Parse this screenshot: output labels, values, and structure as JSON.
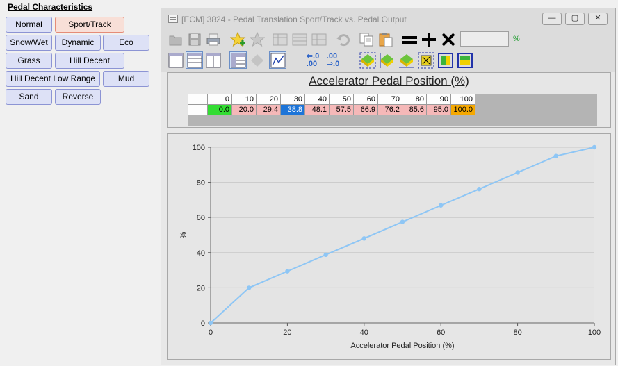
{
  "left_panel": {
    "title": "Pedal Characteristics",
    "buttons": [
      {
        "label": "Normal",
        "active": false
      },
      {
        "label": "Sport/Track",
        "active": true
      },
      {
        "label": "Snow/Wet",
        "active": false
      },
      {
        "label": "Dynamic",
        "active": false
      },
      {
        "label": "Eco",
        "active": false
      },
      {
        "label": "Grass",
        "active": false
      },
      {
        "label": "Hill Decent",
        "active": false
      },
      {
        "label": "Hill Decent Low Range",
        "active": false
      },
      {
        "label": "Mud",
        "active": false
      },
      {
        "label": "Sand",
        "active": false
      },
      {
        "label": "Reverse",
        "active": false
      }
    ]
  },
  "window": {
    "title": "[ECM] 3824 - Pedal Translation Sport/Track vs. Pedal Output",
    "controls": {
      "minimize": "—",
      "maximize": "▢",
      "close": "✕"
    },
    "unit_label": "%",
    "value_box": ""
  },
  "toolbar": {
    "row1_icons": [
      "open-icon",
      "save-icon",
      "print-icon",
      "add-favorite-icon",
      "remove-favorite-icon",
      "table-col-icon",
      "table-row-icon",
      "table-cell-icon",
      "undo-icon",
      "copy-icon",
      "paste-icon",
      "equals-icon",
      "plus-icon",
      "multiply-icon"
    ],
    "row2_icons": [
      "view-table-icon",
      "view-split-h-icon",
      "view-split-v-icon",
      "view-grid-icon",
      "view-3d-icon",
      "view-graph-icon",
      "decimal-left-icon",
      "decimal-right-icon",
      "fill-up-icon",
      "fill-left-icon",
      "fill-diag-icon",
      "select-icon",
      "color-h-icon",
      "color-v-icon"
    ],
    "dec_left": [
      "⇐.0",
      ".00"
    ],
    "dec_right": [
      ".00",
      "⇒.0"
    ]
  },
  "table": {
    "title": "Accelerator Pedal Position (%)",
    "headers": [
      "0",
      "10",
      "20",
      "30",
      "40",
      "50",
      "60",
      "70",
      "80",
      "90",
      "100"
    ],
    "values": [
      "0.0",
      "20.0",
      "29.4",
      "38.8",
      "48.1",
      "57.5",
      "66.9",
      "76.2",
      "85.6",
      "95.0",
      "100.0"
    ],
    "colors": {
      "first": "#33dd33",
      "selected": "#1c74d8",
      "last": "#f5a800",
      "default": "#f5b8b8"
    }
  },
  "chart_data": {
    "type": "line",
    "title": "",
    "xlabel": "Accelerator Pedal Position (%)",
    "ylabel": "%",
    "x": [
      0,
      10,
      20,
      30,
      40,
      50,
      60,
      70,
      80,
      90,
      100
    ],
    "series": [
      {
        "values": [
          0,
          20.0,
          29.4,
          38.8,
          48.1,
          57.5,
          66.9,
          76.2,
          85.6,
          95.0,
          100.0
        ]
      }
    ],
    "xlim": [
      0,
      100
    ],
    "ylim": [
      0,
      100
    ],
    "xticks": [
      "0",
      "20",
      "40",
      "60",
      "80",
      "100"
    ],
    "yticks": [
      "0",
      "20",
      "40",
      "60",
      "80",
      "100"
    ],
    "grid": true,
    "line_color": "#8ec6f5"
  }
}
